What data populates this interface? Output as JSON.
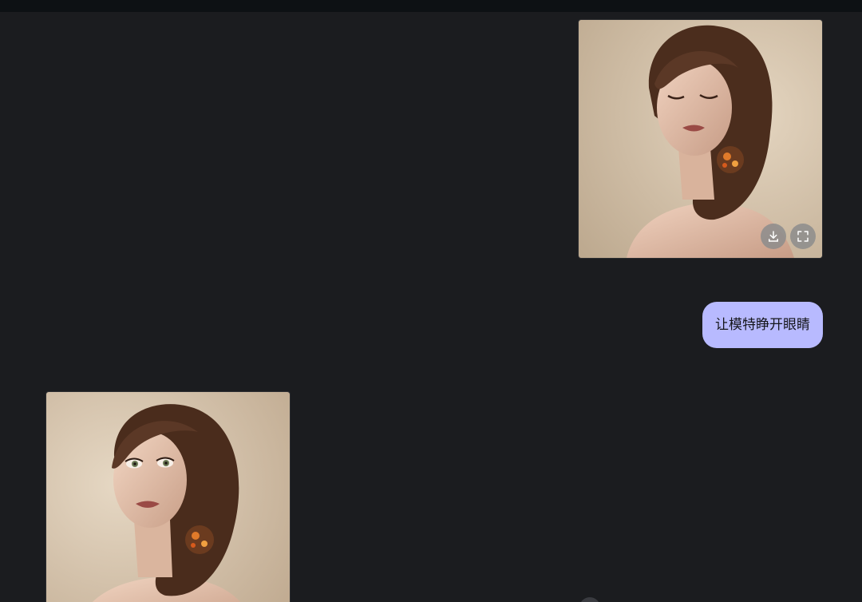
{
  "messages": [
    {
      "role": "user",
      "type": "image",
      "description_icon": "portrait-eyes-closed",
      "actions": [
        {
          "name": "download",
          "icon": "download-icon"
        },
        {
          "name": "expand",
          "icon": "fullscreen-icon"
        }
      ]
    },
    {
      "role": "user",
      "type": "text",
      "text": "让模特睁开眼睛"
    },
    {
      "role": "assistant",
      "type": "image",
      "description_icon": "portrait-eyes-open"
    }
  ],
  "colors": {
    "background": "#1b1c1f",
    "top_bar": "#0d1114",
    "bubble": "#b8baff",
    "bubble_text": "#15161a",
    "photo_backdrop": "#d4c1a6",
    "hair": "#4a2e1f",
    "skin": "#e2bfa8"
  }
}
